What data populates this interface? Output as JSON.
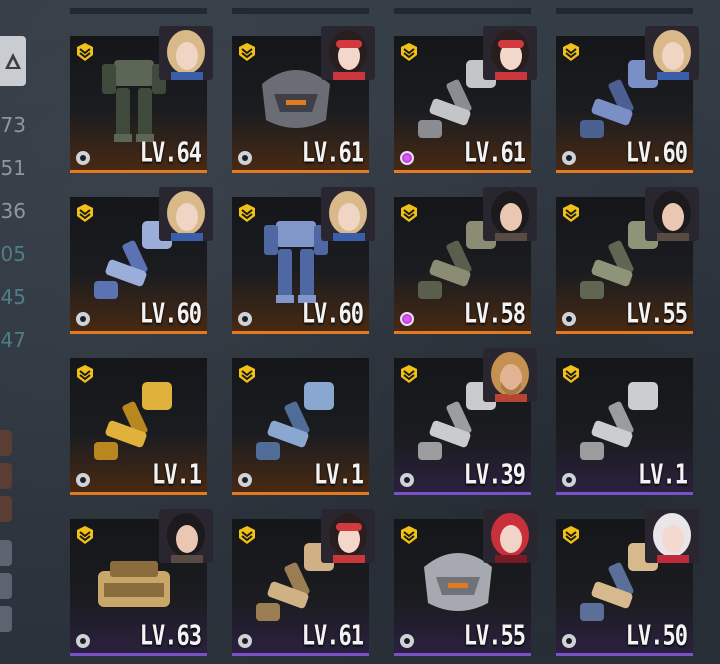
{
  "sidebar": {
    "numbers": [
      "73",
      "51",
      "36",
      "05",
      "45",
      "47"
    ]
  },
  "colors": {
    "common_rarity": "#e37a1f",
    "rare_rarity": "#7a52c7",
    "gem_slot": "#c73fe6",
    "rank_badge": "#f2c118"
  },
  "cards": [
    {
      "level": "LV.64",
      "part": "full-frame",
      "pilot": "blonde-girl",
      "rarity": "orange",
      "slot": "empty"
    },
    {
      "level": "LV.61",
      "part": "head",
      "pilot": "goggles-girl",
      "rarity": "orange",
      "slot": "empty"
    },
    {
      "level": "LV.61",
      "part": "arm",
      "pilot": "goggles-girl",
      "rarity": "orange",
      "slot": "gem"
    },
    {
      "level": "LV.60",
      "part": "arm",
      "pilot": "blonde-girl",
      "rarity": "orange",
      "slot": "empty"
    },
    {
      "level": "LV.60",
      "part": "arm",
      "pilot": "blonde-girl",
      "rarity": "orange",
      "slot": "empty"
    },
    {
      "level": "LV.60",
      "part": "legs",
      "pilot": "blonde-girl",
      "rarity": "orange",
      "slot": "empty"
    },
    {
      "level": "LV.58",
      "part": "arm",
      "pilot": "curly-girl",
      "rarity": "orange",
      "slot": "gem"
    },
    {
      "level": "LV.55",
      "part": "arm",
      "pilot": "curly-girl",
      "rarity": "orange",
      "slot": "empty"
    },
    {
      "level": "LV.1",
      "part": "arm",
      "pilot": "",
      "rarity": "orange",
      "slot": "empty"
    },
    {
      "level": "LV.1",
      "part": "arm",
      "pilot": "",
      "rarity": "orange",
      "slot": "empty"
    },
    {
      "level": "LV.39",
      "part": "arm",
      "pilot": "bearded-man",
      "rarity": "purple",
      "slot": "empty"
    },
    {
      "level": "LV.1",
      "part": "arm",
      "pilot": "",
      "rarity": "purple",
      "slot": "empty"
    },
    {
      "level": "LV.63",
      "part": "core",
      "pilot": "curly-girl",
      "rarity": "purple",
      "slot": "empty"
    },
    {
      "level": "LV.61",
      "part": "arm",
      "pilot": "goggles-girl",
      "rarity": "purple",
      "slot": "empty"
    },
    {
      "level": "LV.55",
      "part": "head",
      "pilot": "red-hair-girl",
      "rarity": "purple",
      "slot": "empty"
    },
    {
      "level": "LV.50",
      "part": "arm",
      "pilot": "white-hair-girl",
      "rarity": "purple",
      "slot": "empty"
    }
  ]
}
